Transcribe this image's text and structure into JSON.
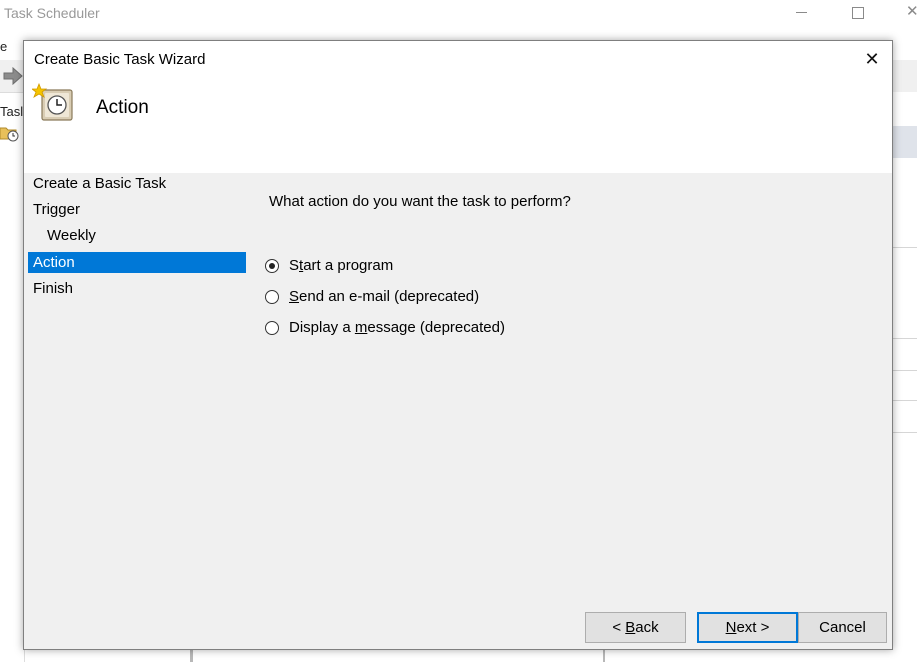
{
  "background_app": {
    "title": "Task Scheduler",
    "menu_fragment": "e",
    "tree_label_fragment": "Tasl"
  },
  "dialog": {
    "title": "Create Basic Task Wizard",
    "close_glyph": "✕",
    "header_title": "Action",
    "nav_items": [
      {
        "label": "Create a Basic Task",
        "active": false,
        "sub": false
      },
      {
        "label": "Trigger",
        "active": false,
        "sub": false
      },
      {
        "label": "Weekly",
        "active": false,
        "sub": true
      },
      {
        "label": "Action",
        "active": true,
        "sub": false
      },
      {
        "label": "Finish",
        "active": false,
        "sub": false
      }
    ],
    "question": "What action do you want the task to perform?",
    "options": [
      {
        "pre": "S",
        "mnemonic": "t",
        "post": "art a program",
        "checked": true
      },
      {
        "pre": "",
        "mnemonic": "S",
        "post": "end an e-mail (deprecated)",
        "checked": false
      },
      {
        "pre": "Display a ",
        "mnemonic": "m",
        "post": "essage (deprecated)",
        "checked": false
      }
    ],
    "buttons": {
      "back": {
        "pre": "< ",
        "mnemonic": "B",
        "post": "ack"
      },
      "next": {
        "pre": "",
        "mnemonic": "N",
        "post": "ext >"
      },
      "cancel": "Cancel"
    }
  },
  "colors": {
    "selection": "#0078d7",
    "dialog_body": "#f0f0f0",
    "header_bg": "#ffffff"
  },
  "icons": {
    "header": "scheduled-task-clock-icon",
    "toolbar_forward": "forward-arrow-icon",
    "tree_folder": "task-folder-icon"
  }
}
